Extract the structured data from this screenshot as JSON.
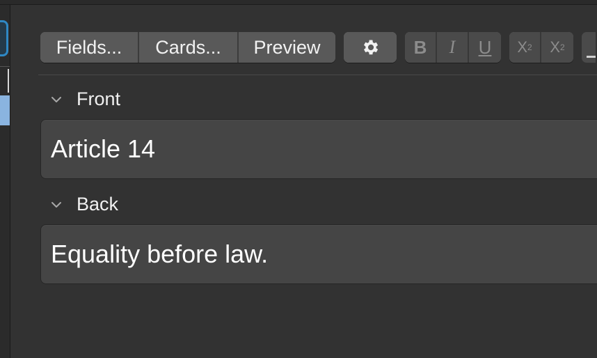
{
  "toolbar": {
    "fields_label": "Fields...",
    "cards_label": "Cards...",
    "preview_label": "Preview",
    "bold_label": "B",
    "italic_label": "I",
    "underline_label": "U",
    "superscript_base": "X",
    "superscript_mark": "2",
    "subscript_base": "X",
    "subscript_mark": "2"
  },
  "fields": [
    {
      "name": "Front",
      "value": "Article 14"
    },
    {
      "name": "Back",
      "value": "Equality before law."
    }
  ],
  "icons": {
    "gear": "gear-icon",
    "chevron": "chevron-down-icon"
  },
  "colors": {
    "background": "#323232",
    "field_bg": "#454545",
    "button_bg": "#595959",
    "accent_blue": "#2f88c4",
    "selection_blue": "#8ab4e0"
  }
}
